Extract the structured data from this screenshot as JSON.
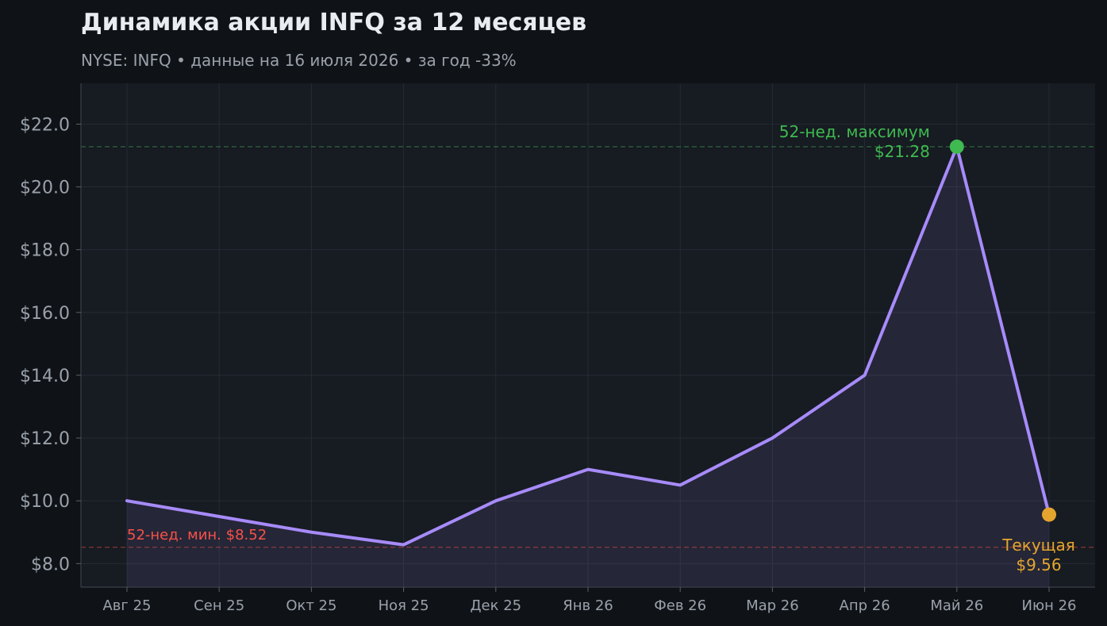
{
  "chart_data": {
    "type": "line",
    "title": "Динамика акции INFQ за 12 месяцев",
    "subtitle": "NYSE: INFQ  •  данные на 16 июля 2026  •  за год -33%",
    "categories": [
      "Авг 25",
      "Сен 25",
      "Окт 25",
      "Ноя 25",
      "Дек 25",
      "Янв 26",
      "Фев 26",
      "Мар 26",
      "Апр 26",
      "Май 26",
      "Июн 26"
    ],
    "values": [
      10.0,
      9.5,
      9.0,
      8.6,
      10.0,
      11.0,
      10.5,
      12.0,
      14.0,
      21.28,
      9.56
    ],
    "ylim": [
      7.25,
      23.3
    ],
    "yticks": [
      8,
      10,
      12,
      14,
      16,
      18,
      20,
      22
    ],
    "ytick_labels": [
      "$8.0",
      "$10.0",
      "$12.0",
      "$14.0",
      "$16.0",
      "$18.0",
      "$20.0",
      "$22.0"
    ],
    "grid": true,
    "high": {
      "value": 21.28,
      "index": 9,
      "label_line1": "52-нед. максимум",
      "label_line2": "$21.28"
    },
    "low": {
      "value": 8.52,
      "label": "52-нед. мин. $8.52"
    },
    "current": {
      "value": 9.56,
      "index": 10,
      "label_line1": "Текущая",
      "label_line2": "$9.56"
    },
    "colors": {
      "line": "#a78bfa",
      "high": "#3fb950",
      "low": "#f85149",
      "current": "#e3a52e",
      "plot_bg": "#171b22",
      "page_bg": "#0f1317",
      "title": "#e9ecf1",
      "muted": "#9aa1ab"
    }
  }
}
